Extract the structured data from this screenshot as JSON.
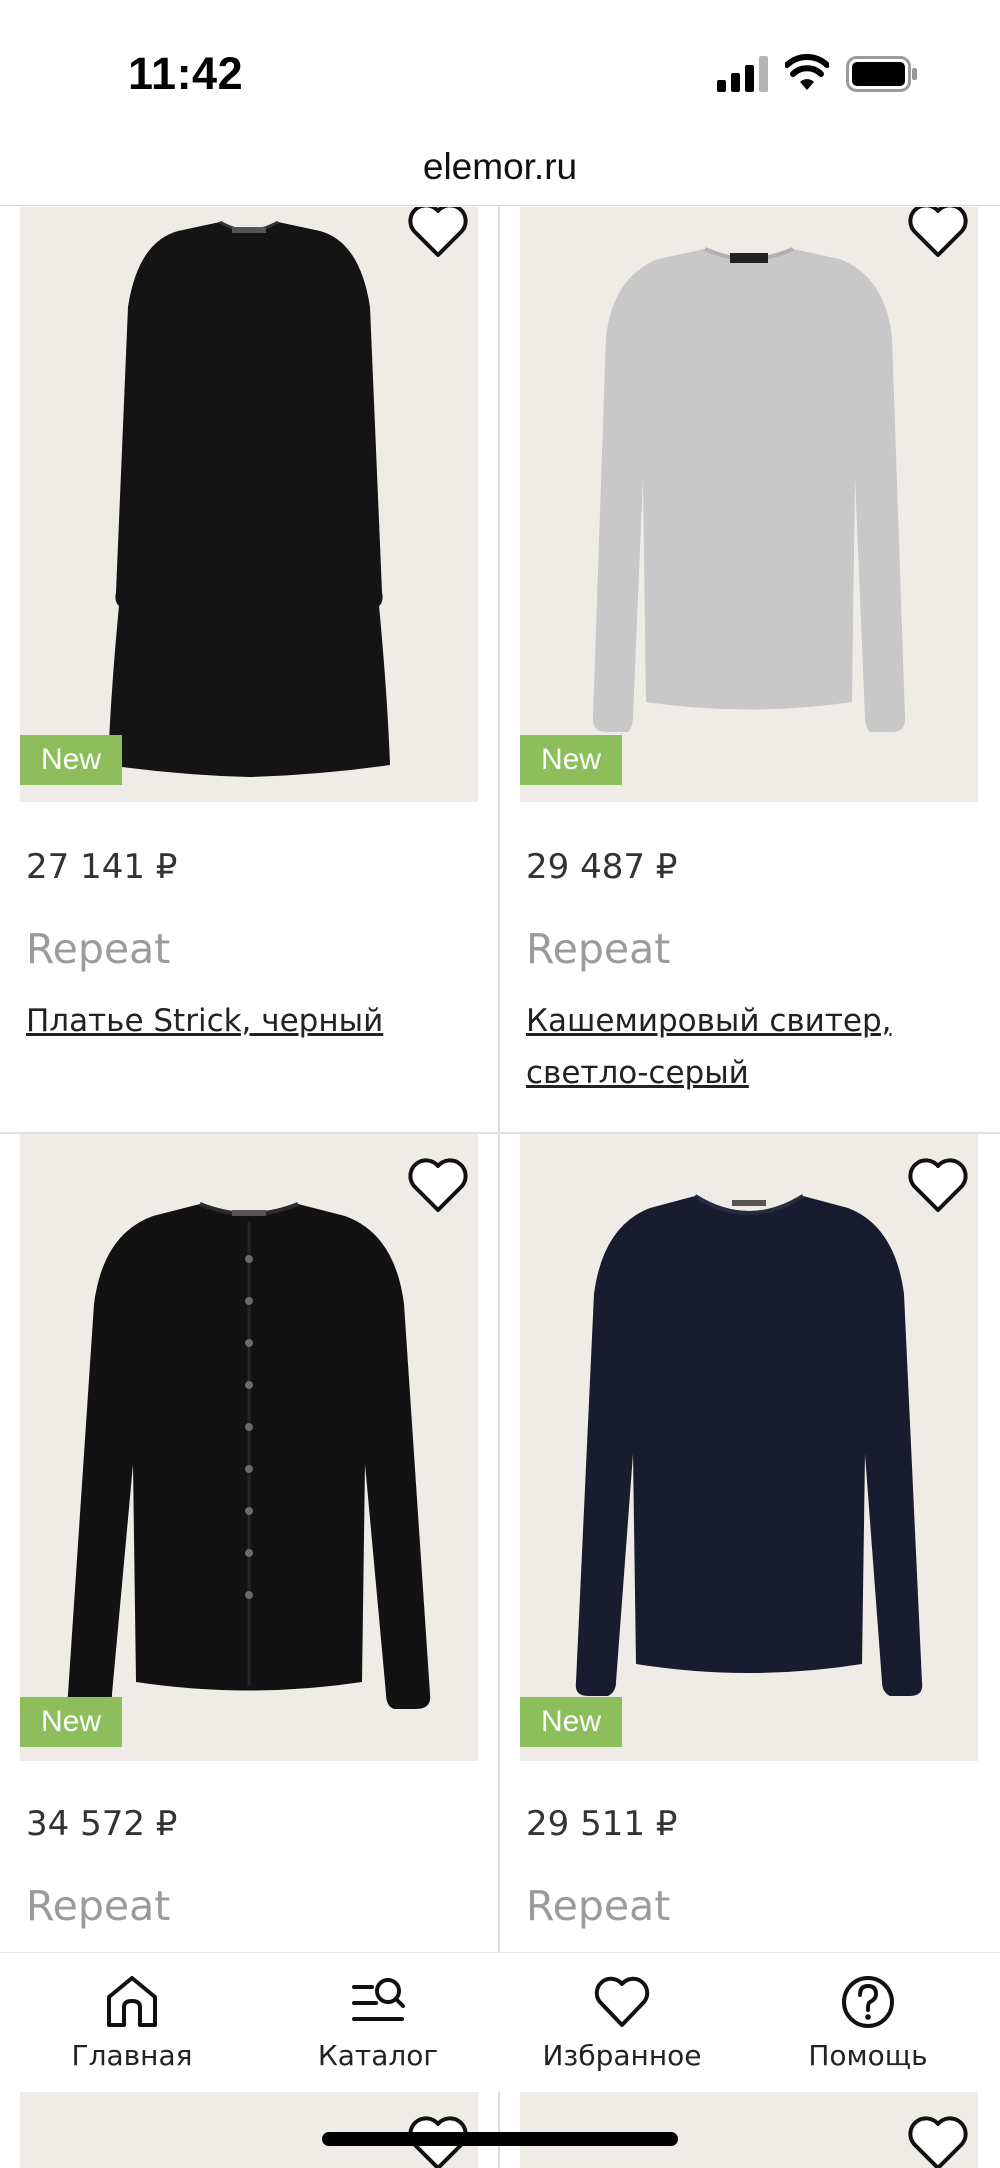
{
  "status_bar": {
    "time": "11:42"
  },
  "browser": {
    "url": "elemor.ru"
  },
  "products": [
    {
      "badge": "New",
      "price": "27 141 ₽",
      "brand": "Repeat",
      "name": "Платье Strick, черный",
      "image_icon": "black-dress-icon",
      "favorite_icon": "heart-icon"
    },
    {
      "badge": "New",
      "price": "29 487 ₽",
      "brand": "Repeat",
      "name": "Кашемировый свитер, светло-серый",
      "image_icon": "grey-sweater-icon",
      "favorite_icon": "heart-icon"
    },
    {
      "badge": "New",
      "price": "34 572 ₽",
      "brand": "Repeat",
      "name": "",
      "image_icon": "black-cardigan-icon",
      "favorite_icon": "heart-icon"
    },
    {
      "badge": "New",
      "price": "29 511 ₽",
      "brand": "Repeat",
      "name": "",
      "image_icon": "navy-sweater-icon",
      "favorite_icon": "heart-icon"
    }
  ],
  "tabbar": {
    "items": [
      {
        "label": "Главная",
        "icon": "home-icon"
      },
      {
        "label": "Каталог",
        "icon": "catalog-search-icon"
      },
      {
        "label": "Избранное",
        "icon": "heart-icon"
      },
      {
        "label": "Помощь",
        "icon": "help-icon"
      }
    ]
  },
  "colors": {
    "badge": "#8cbf5c",
    "image_bg": "#efece8",
    "brand_text": "#9b9b9b"
  }
}
